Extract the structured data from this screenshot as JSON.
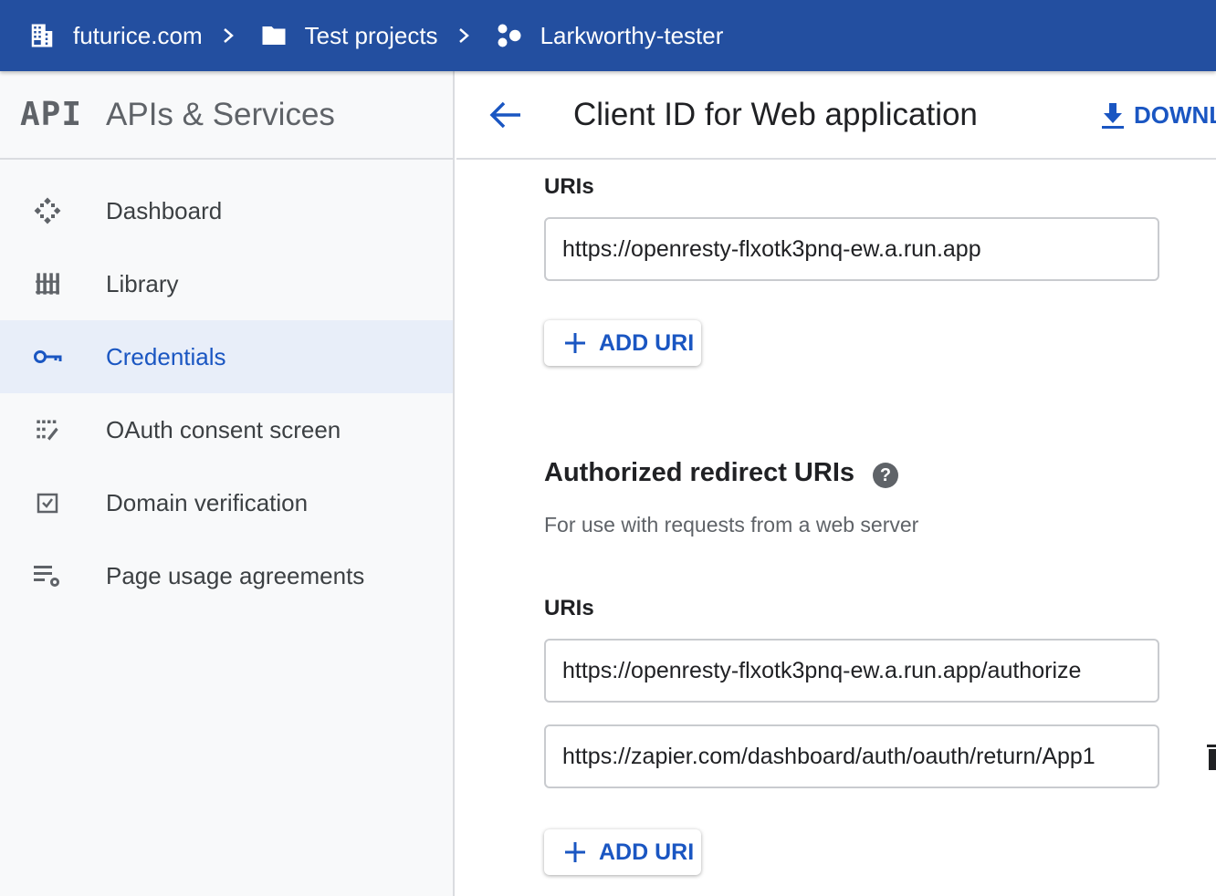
{
  "breadcrumb": {
    "org": "futurice.com",
    "folder": "Test projects",
    "project": "Larkworthy-tester"
  },
  "sidebar": {
    "logo_text": "API",
    "title": "APIs & Services",
    "items": [
      {
        "label": "Dashboard",
        "icon": "dashboard-icon"
      },
      {
        "label": "Library",
        "icon": "library-icon"
      },
      {
        "label": "Credentials",
        "icon": "key-icon",
        "active": true
      },
      {
        "label": "OAuth consent screen",
        "icon": "oauth-consent-icon"
      },
      {
        "label": "Domain verification",
        "icon": "checkbox-icon"
      },
      {
        "label": "Page usage agreements",
        "icon": "settings-list-icon"
      }
    ]
  },
  "main": {
    "title": "Client ID for Web application",
    "download_label": "DOWNLOAD JSON",
    "origins": {
      "uris_label": "URIs",
      "uris": [
        "https://openresty-flxotk3pnq-ew.a.run.app"
      ],
      "add_label": "ADD URI"
    },
    "redirects": {
      "title": "Authorized redirect URIs",
      "help": "?",
      "description": "For use with requests from a web server",
      "uris_label": "URIs",
      "uris": [
        "https://openresty-flxotk3pnq-ew.a.run.app/authorize",
        "https://zapier.com/dashboard/auth/oauth/return/App1"
      ],
      "add_label": "ADD URI"
    }
  },
  "colors": {
    "topbar": "#234fa0",
    "accent": "#1a56c2",
    "active_bg": "#e8eef9"
  }
}
